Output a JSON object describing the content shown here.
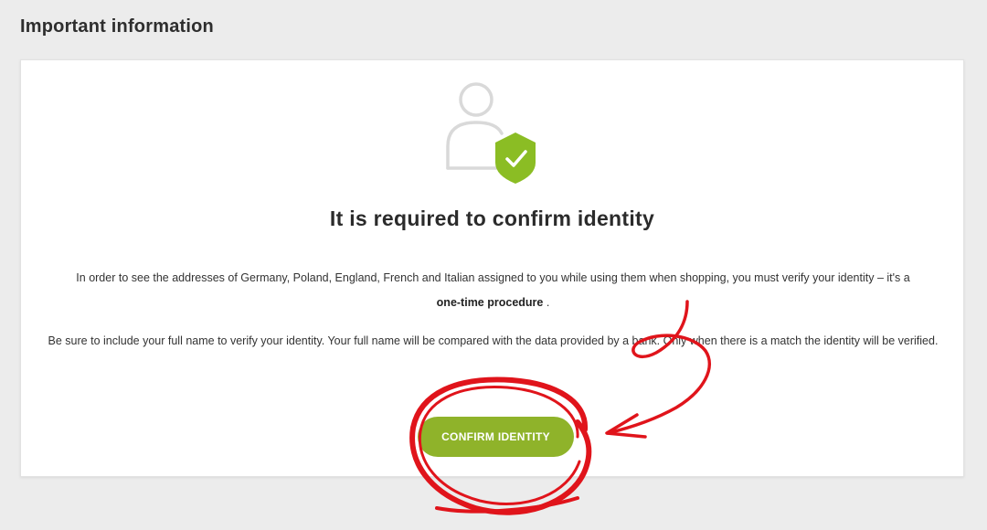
{
  "page": {
    "heading": "Important information"
  },
  "card": {
    "title": "It is required to confirm identity",
    "paragraph1_text": "In order to see the addresses of Germany, Poland, England, French and Italian assigned to you while using them when shopping, you must verify your identity – it's a",
    "paragraph1_bold": "one-time procedure",
    "paragraph1_end": " .",
    "paragraph2_text": "Be sure to include your full name to verify your identity. Your full name will be compared with the data provided by a bank. Only when there is a match the identity will be verified.",
    "confirm_button_label": "CONFIRM IDENTITY",
    "illustration_icon": "user-with-shield-check-icon"
  },
  "colors": {
    "background": "#ececec",
    "card": "#ffffff",
    "accent_green": "#8fb32a",
    "shield_green": "#8bbd24",
    "annotation_red": "#e0141b"
  }
}
